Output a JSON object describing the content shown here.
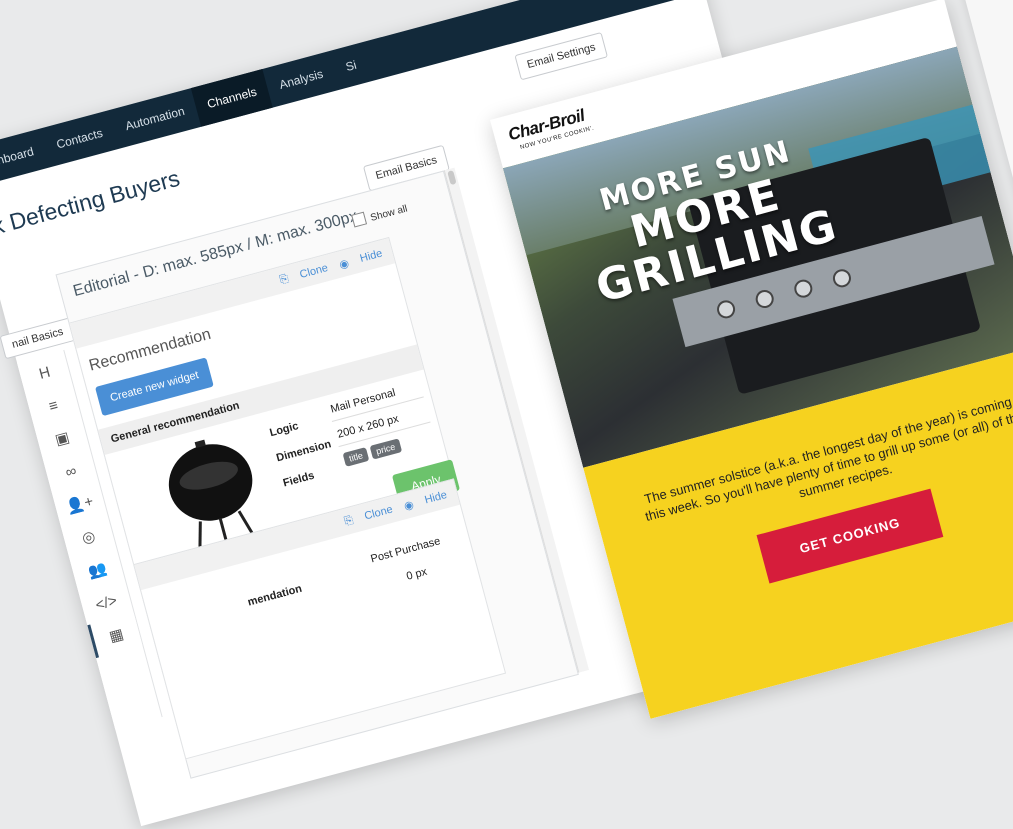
{
  "nav": {
    "items": [
      "Dashboard",
      "Contacts",
      "Automation",
      "Channels",
      "Analysis",
      "Si"
    ],
    "active": "Channels"
  },
  "header": {
    "email_settings": "Email Settings",
    "email_basics": "Email Basics",
    "title": "ck Defecting Buyers"
  },
  "editor": {
    "tab_label": "nail Basics",
    "panel_title": "Editorial - D: max. 585px / M: max. 300px",
    "show_all": "Show all",
    "widget1": {
      "title": "Recommendation",
      "clone": "Clone",
      "hide": "Hide",
      "create_button": "Create new widget",
      "section": "General recommendation",
      "logic_label": "Logic",
      "logic_value": "Mail Personal",
      "dimension_label": "Dimension",
      "dimension_value": "200 x 260 px",
      "fields_label": "Fields",
      "fields": [
        "title",
        "price"
      ],
      "apply": "Apply"
    },
    "widget2": {
      "clone": "Clone",
      "hide": "Hide",
      "section": "mendation",
      "logic_value": "Post Purchase",
      "dimension_partial": "0 px"
    },
    "tools": [
      "H",
      "≡",
      "▣",
      "∞",
      "👤+",
      "◎",
      "👥",
      "</>",
      "▦"
    ]
  },
  "email": {
    "brand": "Char-Broil",
    "tagline": "NOW YOU'RE COOKIN'.",
    "hero_line1": "MORE SUN",
    "hero_line2": "MORE",
    "hero_line3": "GRILLING",
    "body_copy": "The summer solstice (a.k.a. the longest day of the year) is coming up this week. So you'll have plenty of time to grill up some (or all) of these summer recipes.",
    "cta": "GET COOKING",
    "colors": {
      "promo_bg": "#f6d21f",
      "cta_bg": "#d61d3b",
      "nav_bg": "#12293a",
      "link": "#4a8fd6",
      "apply": "#6cc36c"
    }
  }
}
